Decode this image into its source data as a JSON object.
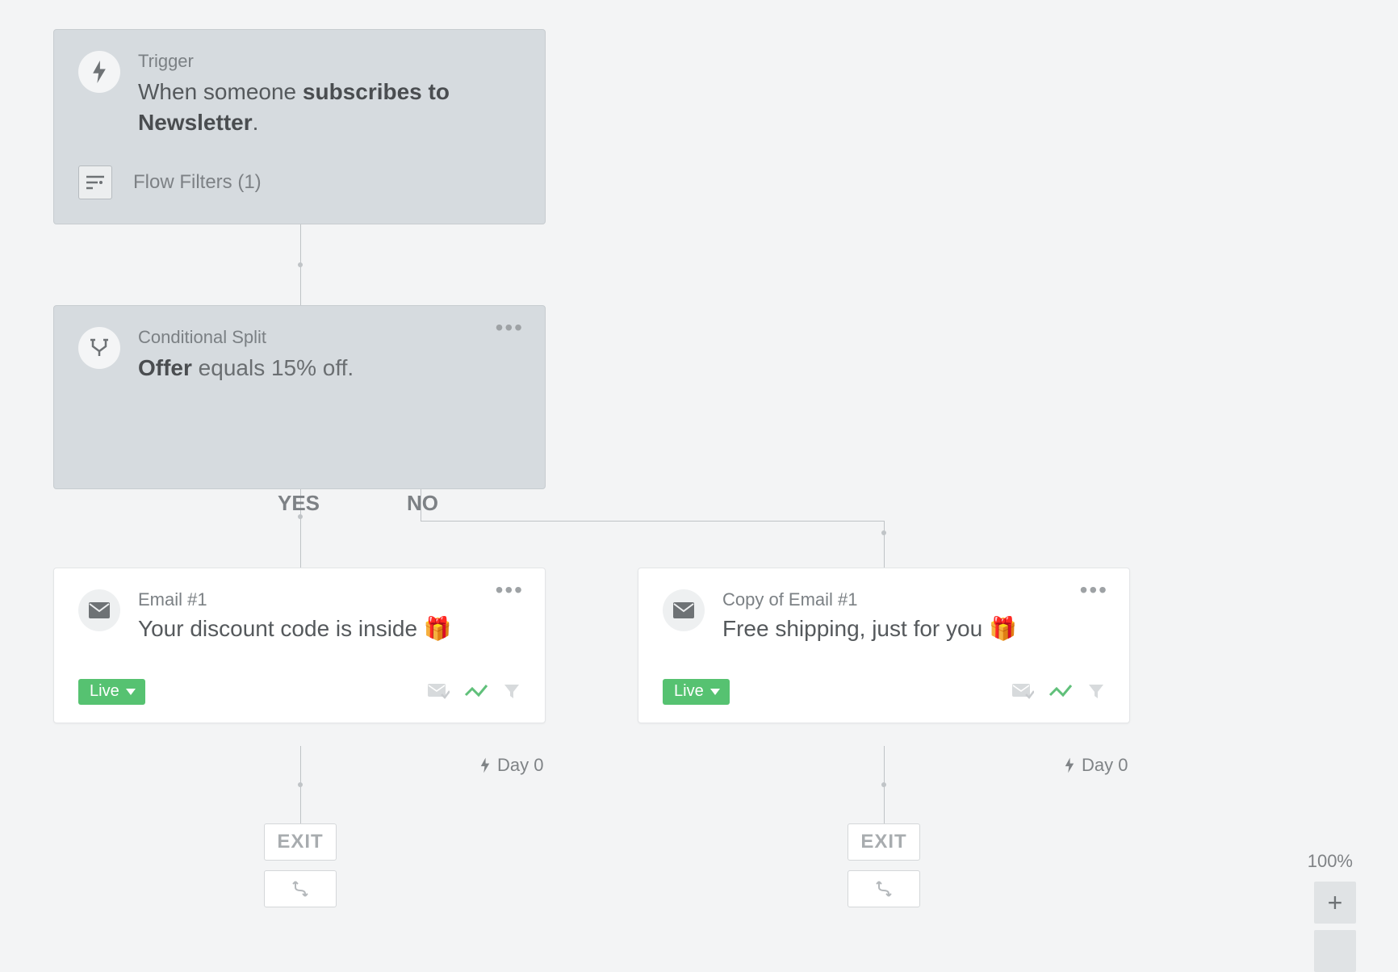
{
  "trigger": {
    "label": "Trigger",
    "text_prefix": "When someone ",
    "text_strong": "subscribes to Newsletter",
    "text_suffix": ".",
    "filters_label": "Flow Filters (1)"
  },
  "split": {
    "label": "Conditional Split",
    "field": "Offer",
    "condition": " equals 15% off."
  },
  "branches": {
    "yes": "YES",
    "no": "NO"
  },
  "email_yes": {
    "label": "Email #1",
    "subject": "Your discount code is inside ",
    "emoji": "🎁",
    "status": "Live",
    "timing": "Day 0"
  },
  "email_no": {
    "label": "Copy of Email #1",
    "subject": "Free shipping, just for you ",
    "emoji": "🎁",
    "status": "Live",
    "timing": "Day 0"
  },
  "exit_label": "EXIT",
  "zoom": {
    "level": "100%",
    "plus": "+"
  }
}
